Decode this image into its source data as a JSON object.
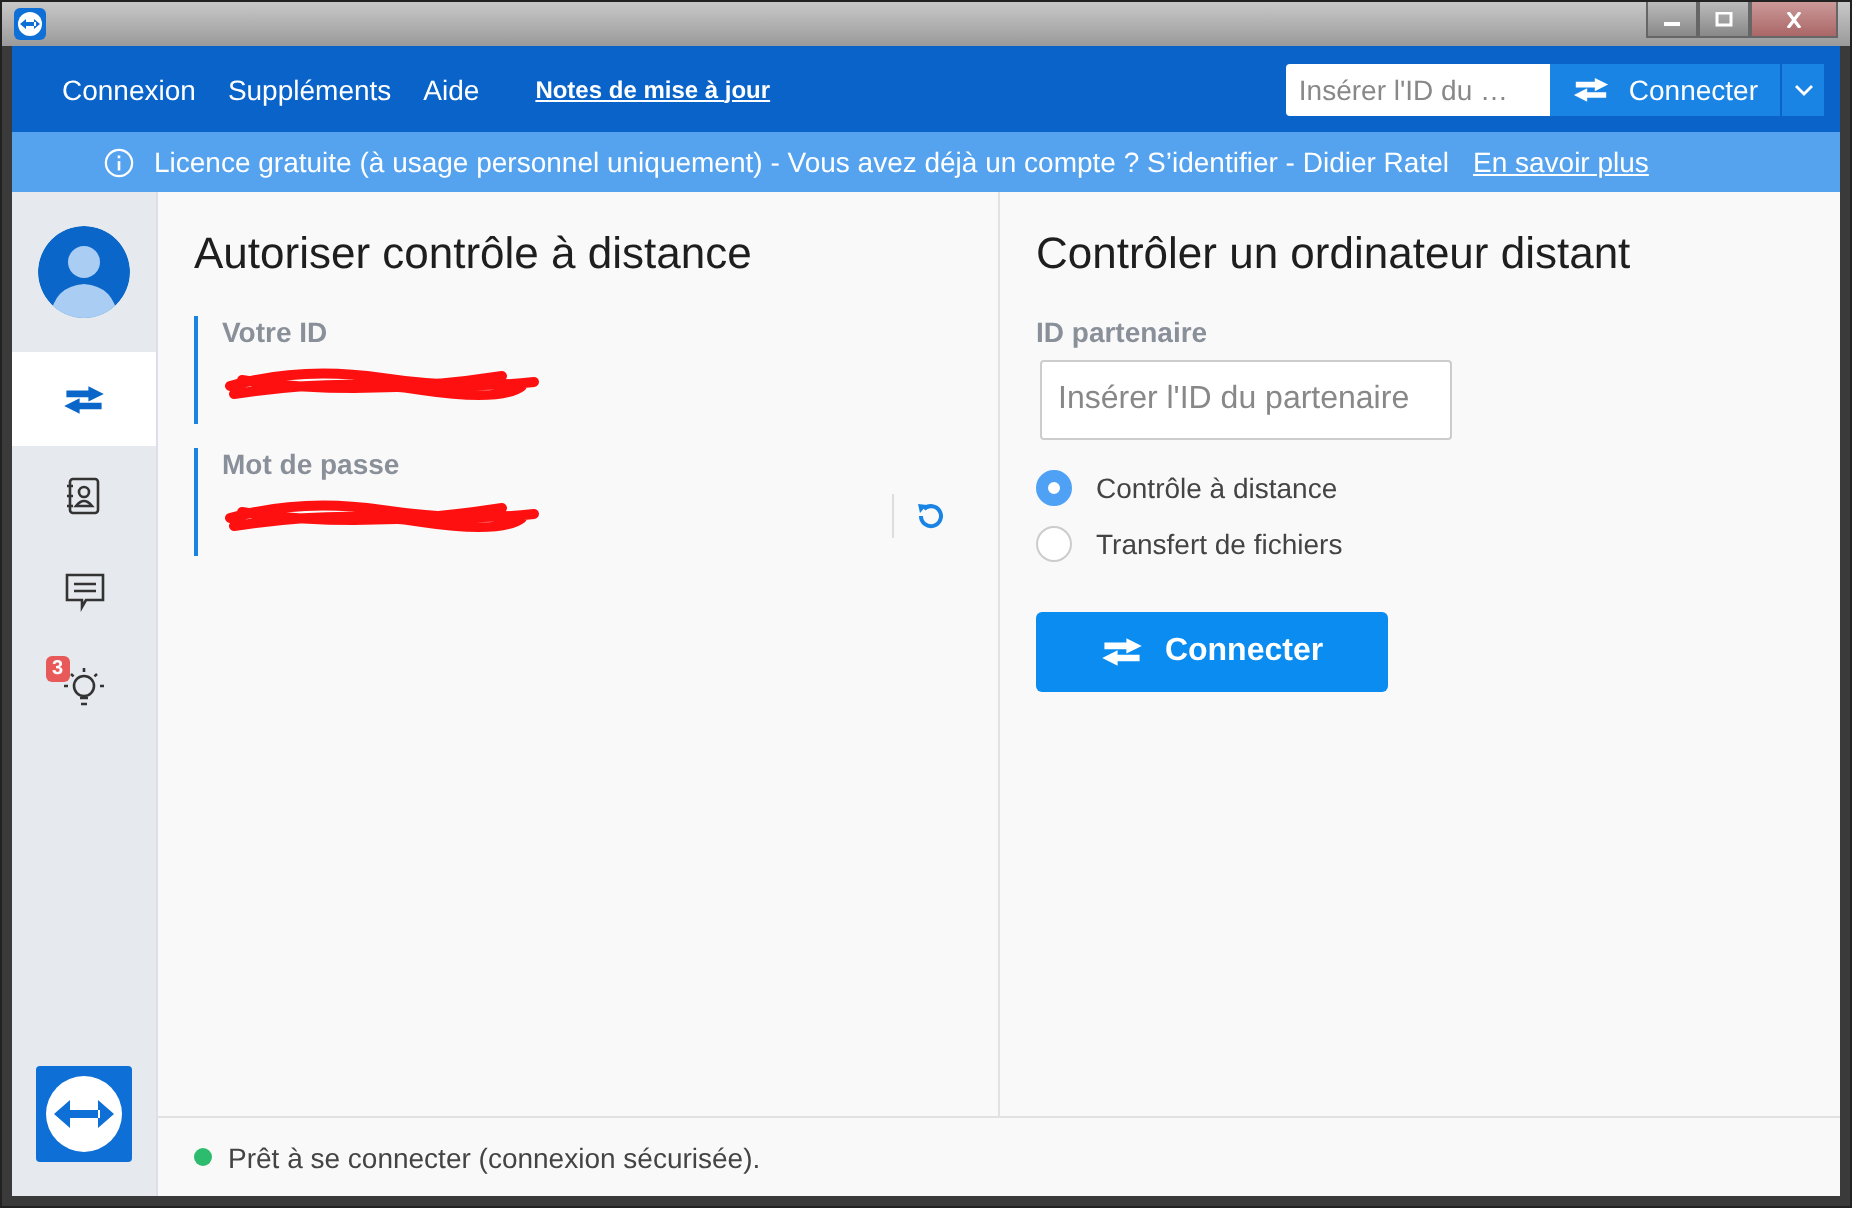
{
  "menu": [
    {
      "label": "Connexion",
      "kind": "menu"
    },
    {
      "label": "Suppléments",
      "kind": "menu"
    },
    {
      "label": "Aide",
      "kind": "menu"
    },
    {
      "label": "Notes de mise à jour",
      "kind": "link"
    }
  ],
  "quick_connect": {
    "placeholder": "Insérer l'ID du …",
    "button": "Connecter"
  },
  "banner": {
    "text": "Licence gratuite (à usage personnel uniquement) - Vous avez déjà un compte ? S’identifier - Didier Ratel",
    "link": "En savoir plus"
  },
  "sidebar": {
    "items": [
      {
        "kind": "remote",
        "selected": true
      },
      {
        "kind": "contacts",
        "selected": false
      },
      {
        "kind": "chat",
        "selected": false
      },
      {
        "kind": "tips",
        "selected": false,
        "badge": "3"
      }
    ]
  },
  "allow": {
    "title": "Autoriser contrôle à distance",
    "fields": [
      {
        "label": "Votre ID",
        "redacted": true,
        "refresh": false
      },
      {
        "label": "Mot de passe",
        "redacted": true,
        "refresh": true
      }
    ]
  },
  "control": {
    "title": "Contrôler un ordinateur distant",
    "label": "ID partenaire",
    "placeholder": "Insérer l'ID du partenaire",
    "options": [
      {
        "label": "Contrôle à distance",
        "selected": true
      },
      {
        "label": "Transfert de fichiers",
        "selected": false
      }
    ],
    "button": "Connecter"
  },
  "status": {
    "text": "Prêt à se connecter (connexion sécurisée).",
    "ready": true
  }
}
